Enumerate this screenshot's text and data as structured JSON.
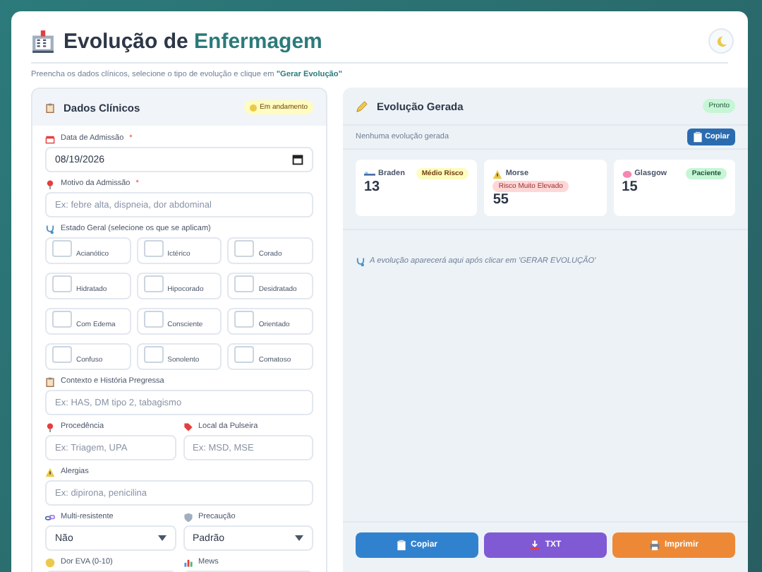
{
  "header": {
    "title": "Evolução de",
    "title_accent": "Enfermagem",
    "subtitle": "Preencha os dados clínicos, selecione o tipo de evolução e clique em **\"Gerar Evolução\"**"
  },
  "form_panel": {
    "title": "Dados Clínicos",
    "badge": {
      "label": "Em andamento",
      "kind": "warning"
    },
    "rows": [
      [
        {
          "kind": "date",
          "label": "Data de Admissão",
          "required_mark": "*",
          "value": "08/19/2026"
        }
      ],
      [
        {
          "kind": "text",
          "label": "Motivo da Admissão",
          "required_mark": "*",
          "placeholder": "Ex: febre alta, dispneia, dor abdominal"
        }
      ],
      [
        {
          "kind": "checkgroup",
          "label": "Estado Geral (selecione os que se aplicam)",
          "options": [
            {
              "label": "Acianótico",
              "checked": false
            },
            {
              "label": "Ictérico",
              "checked": false
            },
            {
              "label": "Corado",
              "checked": false
            },
            {
              "label": "Hidratado",
              "checked": false
            },
            {
              "label": "Hipocorado",
              "checked": false
            },
            {
              "label": "Desidratado",
              "checked": false
            },
            {
              "label": "Com Edema",
              "checked": false
            },
            {
              "label": "Consciente",
              "checked": false
            },
            {
              "label": "Orientado",
              "checked": false
            },
            {
              "label": "Confuso",
              "checked": false
            },
            {
              "label": "Sonolento",
              "checked": false
            },
            {
              "label": "Comatoso",
              "checked": false
            }
          ]
        }
      ],
      [
        {
          "kind": "text",
          "label": "Contexto e História Pregressa",
          "placeholder": "Ex: HAS, DM tipo 2, tabagismo"
        }
      ],
      [
        {
          "kind": "text",
          "label": "Procedência",
          "placeholder": "Ex: Triagem, UPA"
        },
        {
          "kind": "text",
          "label": "Local da Pulseira",
          "placeholder": "Ex: MSD, MSE"
        }
      ],
      [
        {
          "kind": "text",
          "label": "Alergias",
          "placeholder": "Ex: dipirona, penicilina"
        }
      ],
      [
        {
          "kind": "select",
          "label": "Multi-resistente",
          "value": "Não"
        },
        {
          "kind": "select",
          "label": "Precaução",
          "value": "Padrão"
        }
      ],
      [
        {
          "kind": "text",
          "label": "Dor EVA (0-10)"
        },
        {
          "kind": "text",
          "label": "Mews"
        }
      ]
    ]
  },
  "output_panel": {
    "title": "Evolução Gerada",
    "badge": {
      "label": "Pronto",
      "kind": "success"
    },
    "status": "Nenhuma evolução gerada",
    "copy_button": "Copiar",
    "scores": [
      {
        "name": "Braden",
        "value": "13",
        "badge": {
          "label": "Médio Risco",
          "kind": "warning"
        },
        "badge_below": false
      },
      {
        "name": "Morse",
        "value": "55",
        "badge": {
          "label": "Risco Muito Elevado",
          "kind": "danger"
        },
        "badge_below": true
      },
      {
        "name": "Glasgow",
        "value": "15",
        "badge": {
          "label": "Paciente",
          "kind": "success"
        },
        "badge_below": false
      }
    ],
    "message": "A evolução aparecerá aqui após clicar em 'GERAR EVOLUÇÃO'",
    "actions": [
      {
        "label": "Copiar",
        "color": "#3182ce"
      },
      {
        "label": "TXT",
        "color": "#805ad5"
      },
      {
        "label": "Imprimir",
        "color": "#ed8936"
      }
    ]
  }
}
